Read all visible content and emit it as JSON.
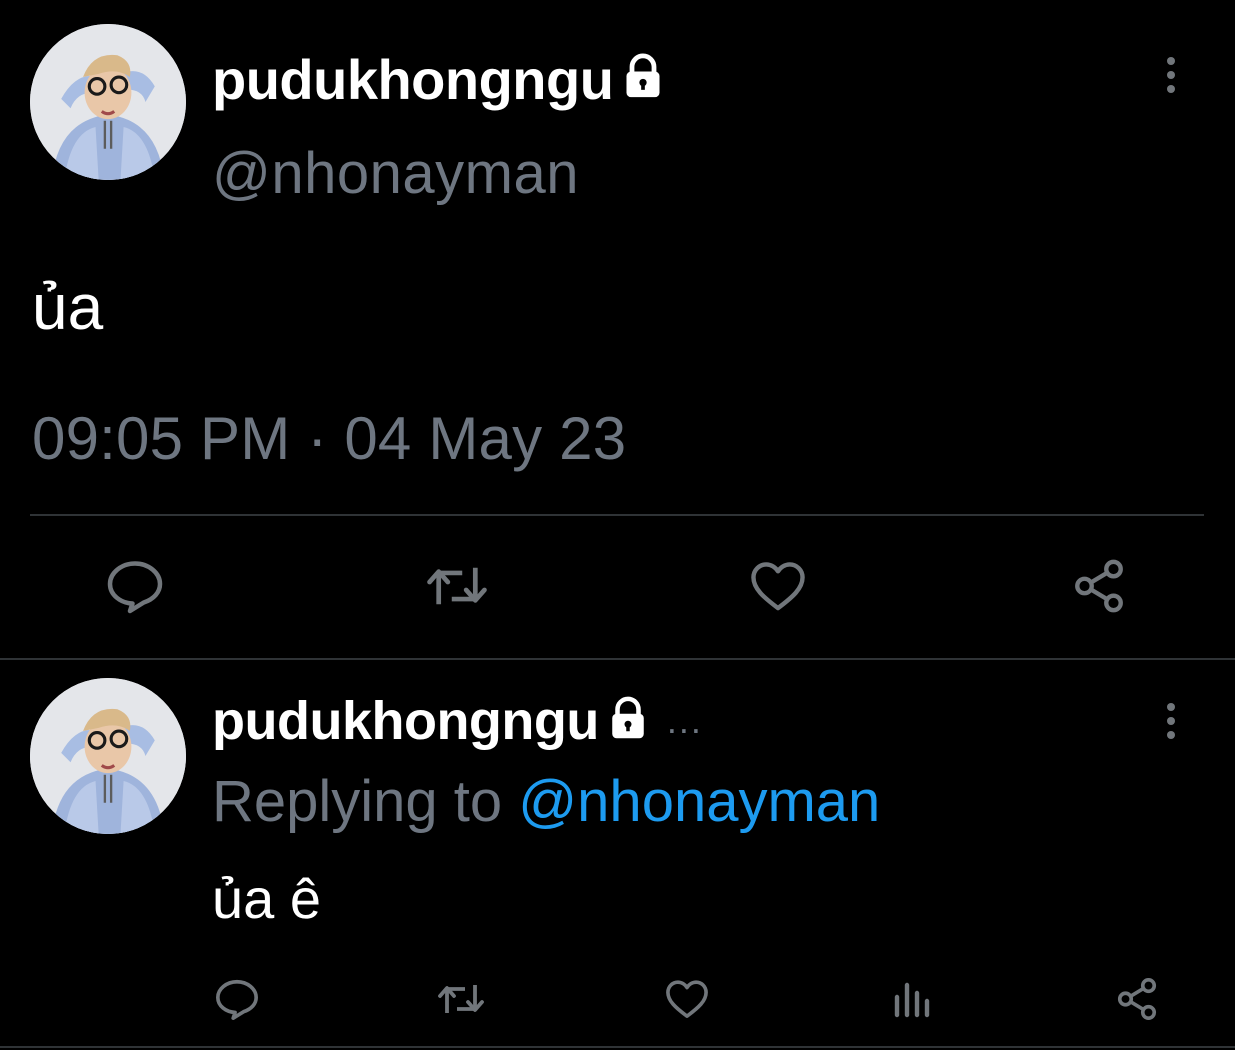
{
  "colors": {
    "background": "#000000",
    "text_primary": "#ffffff",
    "text_secondary": "#6e7681",
    "link": "#1d9bf0",
    "divider": "#2f3336"
  },
  "main_tweet": {
    "display_name": "pudukhongngu",
    "handle": "@nhonayman",
    "text": "ủa",
    "timestamp": "09:05 PM · 04 May 23",
    "icons": [
      "lock-icon",
      "more-vertical-icon",
      "reply-icon",
      "retweet-icon",
      "like-icon",
      "share-icon"
    ]
  },
  "reply_tweet": {
    "display_name": "pudukhongngu",
    "ellipsis": "...",
    "replying_prefix": "Replying to ",
    "replying_handle": "@nhonayman",
    "text": "ủa ê",
    "icons": [
      "lock-icon",
      "more-vertical-icon",
      "reply-icon",
      "retweet-icon",
      "like-icon",
      "views-icon",
      "share-icon"
    ]
  }
}
